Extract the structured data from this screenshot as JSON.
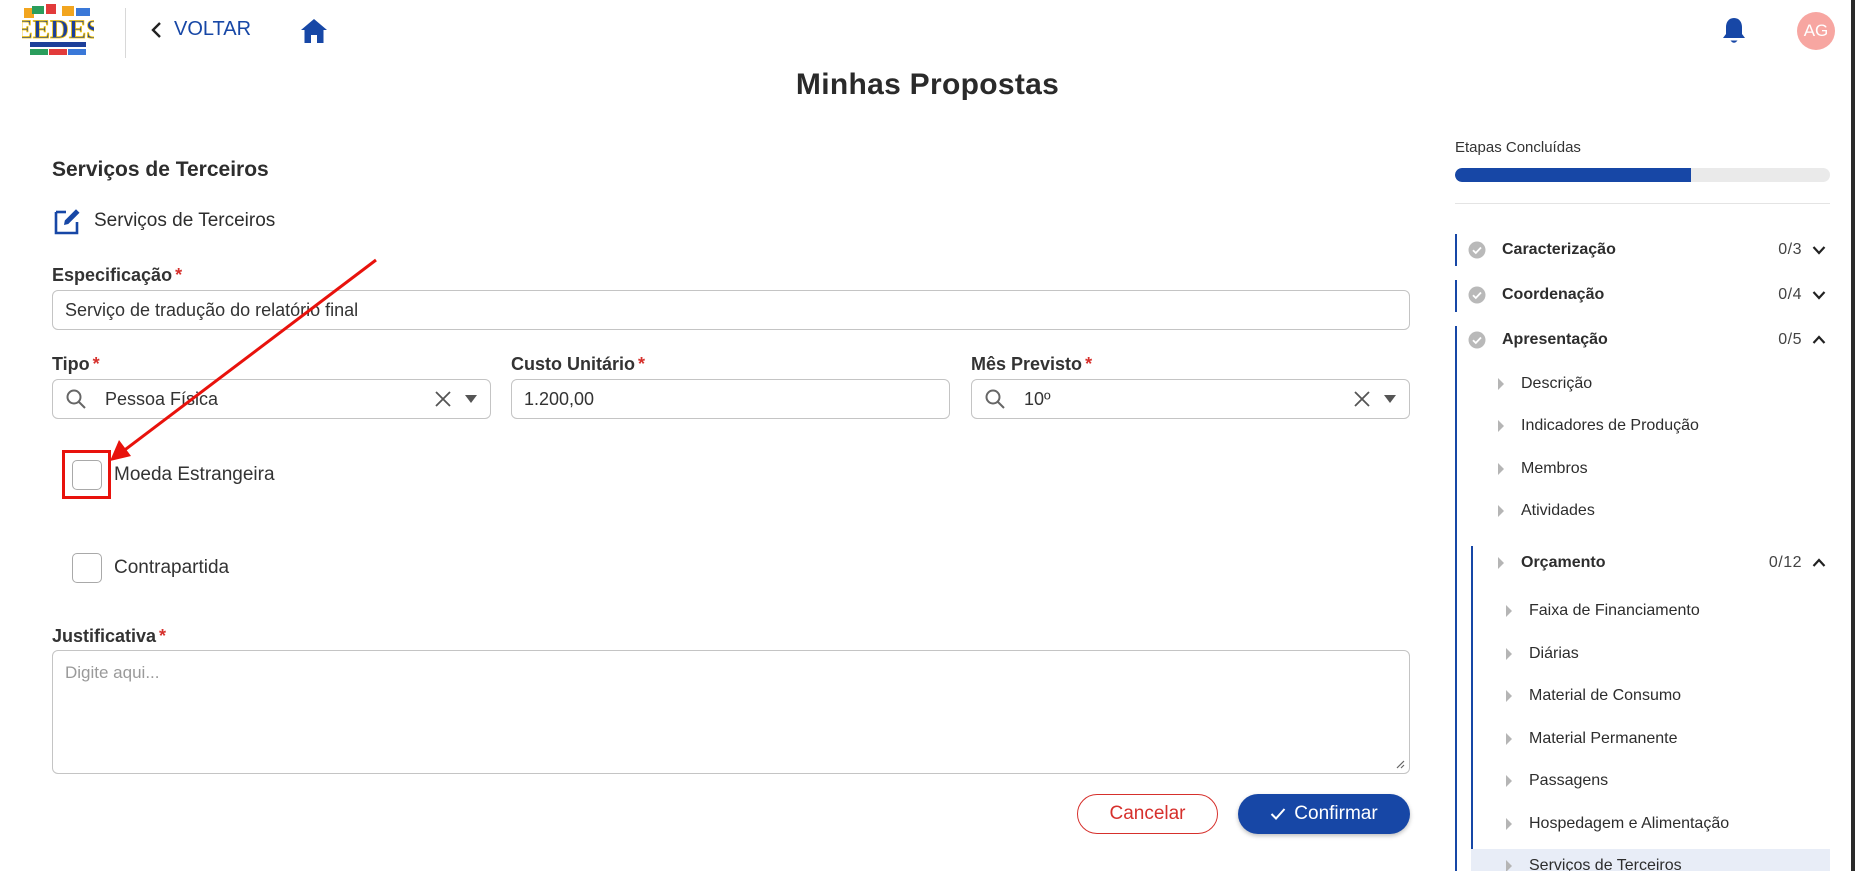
{
  "header": {
    "logo_alt": "EEDES Engenharia de Software",
    "back_label": "VOLTAR",
    "avatar_initials": "AG"
  },
  "page_title": "Minhas Propostas",
  "form": {
    "section_title": "Serviços de Terceiros",
    "subsection_title": "Serviços de Terceiros",
    "especificacao": {
      "label": "Especificação",
      "required_mark": "*",
      "value": "Serviço de tradução do relatório final"
    },
    "tipo": {
      "label": "Tipo",
      "required_mark": "*",
      "value": "Pessoa Física"
    },
    "custo_unitario": {
      "label": "Custo Unitário",
      "required_mark": "*",
      "value": "1.200,00"
    },
    "mes_previsto": {
      "label": "Mês Previsto",
      "required_mark": "*",
      "value": "10º"
    },
    "moeda_estrangeira": {
      "label": "Moeda Estrangeira",
      "checked": false
    },
    "contrapartida": {
      "label": "Contrapartida",
      "checked": false
    },
    "justificativa": {
      "label": "Justificativa",
      "required_mark": "*",
      "placeholder": "Digite aqui..."
    },
    "cancel_label": "Cancelar",
    "confirm_label": "Confirmar"
  },
  "sidebar": {
    "title": "Etapas Concluídas",
    "progress_fraction": 0.63,
    "steps": [
      {
        "name": "Caracterização",
        "count": "0/3",
        "expanded": false
      },
      {
        "name": "Coordenação",
        "count": "0/4",
        "expanded": false
      },
      {
        "name": "Apresentação",
        "count": "0/5",
        "expanded": true
      }
    ],
    "apresentacao_items": [
      "Descrição",
      "Indicadores de Produção",
      "Membros",
      "Atividades"
    ],
    "orcamento": {
      "name": "Orçamento",
      "count": "0/12"
    },
    "orcamento_items": [
      "Faixa de Financiamento",
      "Diárias",
      "Material de Consumo",
      "Material Permanente",
      "Passagens",
      "Hospedagem e Alimentação",
      "Serviços de Terceiros"
    ]
  },
  "colors": {
    "primary": "#1747a6",
    "danger": "#d6302c",
    "avatar_bg": "#f7a6a1",
    "annotation": "#e8120c"
  }
}
